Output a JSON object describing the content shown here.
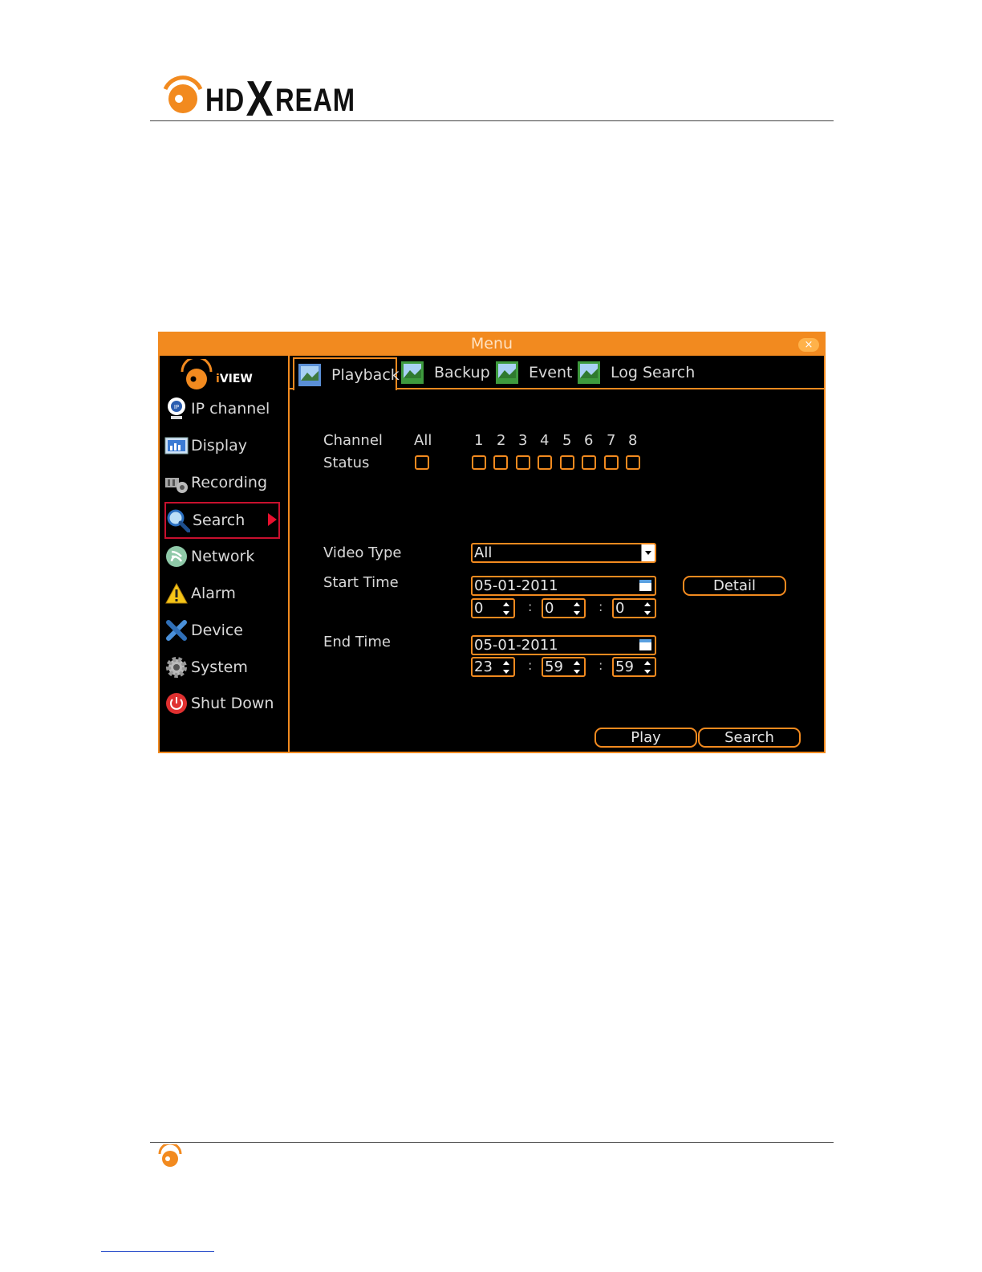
{
  "doc": {
    "brand_left": "HD",
    "brand_x": "X",
    "brand_right": "REAM"
  },
  "window": {
    "title": "Menu",
    "close_glyph": "×"
  },
  "sidebar": {
    "logo_text": "VIEW",
    "items": [
      {
        "label": "IP channel",
        "icon": "ip-camera-icon"
      },
      {
        "label": "Display",
        "icon": "display-icon"
      },
      {
        "label": "Recording",
        "icon": "recording-icon"
      },
      {
        "label": "Search",
        "icon": "search-icon",
        "active": true
      },
      {
        "label": "Network",
        "icon": "network-icon"
      },
      {
        "label": "Alarm",
        "icon": "alarm-icon"
      },
      {
        "label": "Device",
        "icon": "device-icon"
      },
      {
        "label": "System",
        "icon": "system-icon"
      },
      {
        "label": "Shut Down",
        "icon": "power-icon"
      }
    ]
  },
  "tabs": [
    {
      "label": "Playback",
      "active": true
    },
    {
      "label": "Backup"
    },
    {
      "label": "Event"
    },
    {
      "label": "Log Search"
    }
  ],
  "form": {
    "channel_label": "Channel",
    "status_label": "Status",
    "all_label": "All",
    "channels": [
      "1",
      "2",
      "3",
      "4",
      "5",
      "6",
      "7",
      "8"
    ],
    "video_type_label": "Video Type",
    "video_type_value": "All",
    "start_time_label": "Start Time",
    "start_date": "05-01-2011",
    "start_h": "0",
    "start_m": "0",
    "start_s": "0",
    "end_time_label": "End Time",
    "end_date": "05-01-2011",
    "end_h": "23",
    "end_m": "59",
    "end_s": "59",
    "colon": ":",
    "detail_button": "Detail",
    "play_button": "Play",
    "search_button": "Search"
  },
  "colors": {
    "accent": "#f28a1f",
    "active_outline": "#c8102e",
    "background": "#000000"
  }
}
